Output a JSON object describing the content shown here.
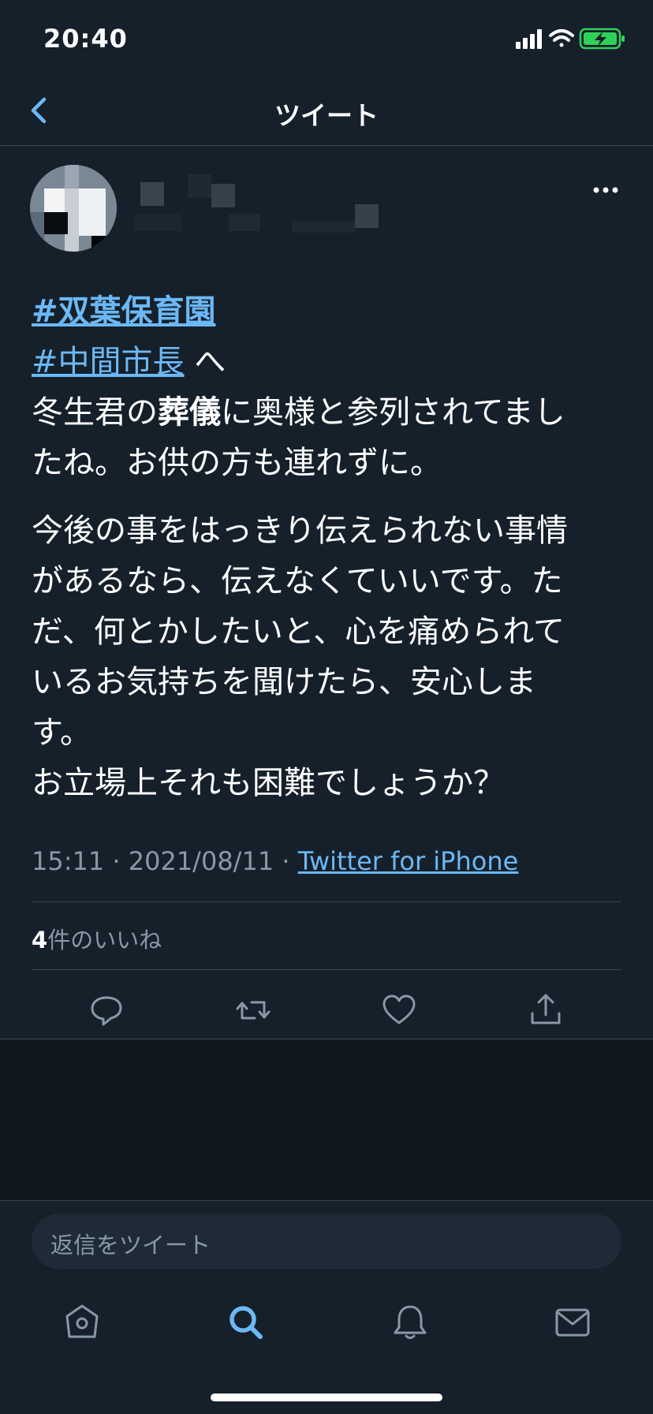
{
  "status_bar": {
    "time": "20:40"
  },
  "nav": {
    "title": "ツイート"
  },
  "tweet": {
    "line1_hashtag": "#双葉保育園",
    "line2_hashtag": "#中間市長",
    "line2_rest": " へ",
    "line3_a": "冬生君の",
    "line3_bold": "葬儀",
    "line3_b": "に奥様と参列されてまし",
    "line4": "たね。お供の方も連れずに。",
    "para2_lines": [
      "今後の事をはっきり伝えられない事情",
      "があるなら、伝えなくていいです。た",
      "だ、何とかしたいと、心を痛められて",
      "いるお気持ちを聞けたら、安心しま",
      "す。",
      "お立場上それも困難でしょうか？"
    ],
    "meta_time": "15:11 · 2021/08/11 · ",
    "meta_source": "Twitter for iPhone",
    "likes_count": "4",
    "likes_label": "件のいいね"
  },
  "reply": {
    "placeholder": "返信をツイート"
  },
  "colors": {
    "background": "#15202b",
    "accent": "#6cb8f5",
    "muted": "#8899a6",
    "divider": "#38444d"
  },
  "icons": {
    "status": [
      "signal-icon",
      "wifi-icon",
      "battery-charging-icon"
    ],
    "actions": [
      "reply-icon",
      "retweet-icon",
      "like-icon",
      "share-icon"
    ],
    "tabs": [
      "home-icon",
      "search-icon",
      "notifications-icon",
      "messages-icon"
    ]
  }
}
